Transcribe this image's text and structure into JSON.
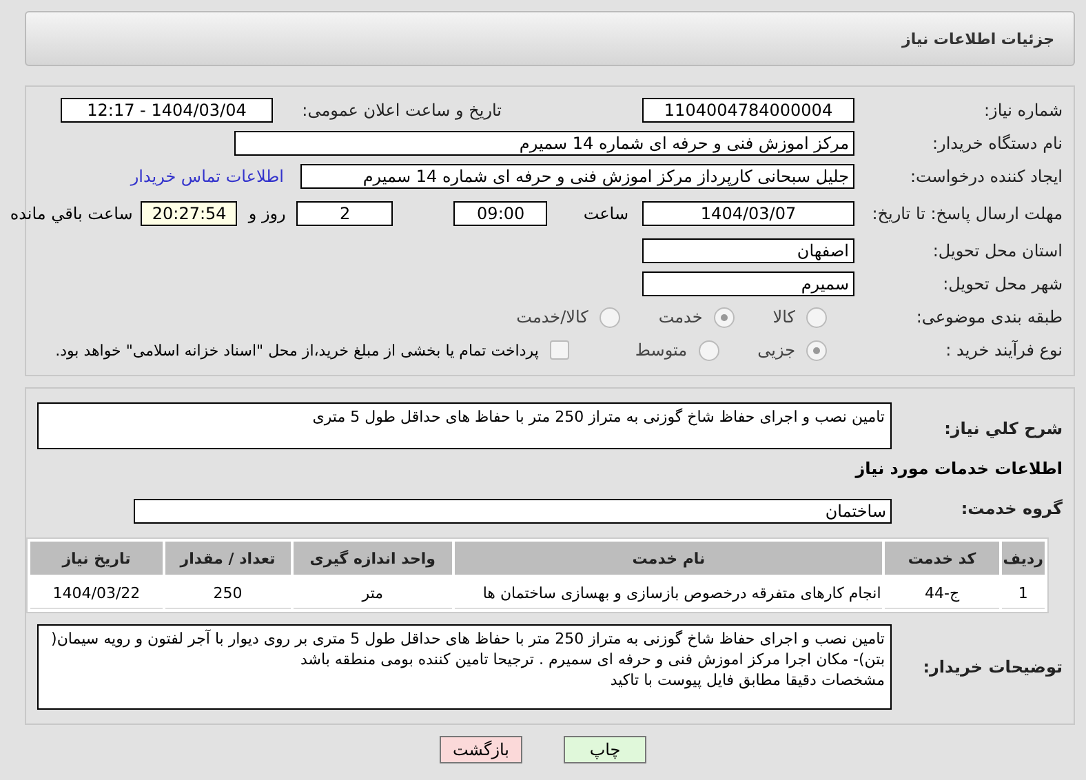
{
  "header": {
    "title": "جزئیات اطلاعات نیاز"
  },
  "need_number": {
    "label": "شماره نیاز:",
    "value": "1104004784000004"
  },
  "announce": {
    "label": "تاریخ و ساعت اعلان عمومی:",
    "value": "1404/03/04 - 12:17"
  },
  "buyer": {
    "label": "نام دستگاه خریدار:",
    "value": "مرکز اموزش فنی و حرفه ای شماره 14  سمیرم"
  },
  "creator": {
    "label": "ایجاد کننده درخواست:",
    "value": "جلیل سبحانی کارپرداز مرکز اموزش فنی و حرفه ای شماره 14  سمیرم",
    "link": "اطلاعات تماس خریدار"
  },
  "deadline": {
    "label": "مهلت ارسال پاسخ: تا تاریخ:",
    "date": "1404/03/07",
    "time_label": "ساعت",
    "time": "09:00",
    "days": "2",
    "days_label": "روز و",
    "remaining": "20:27:54",
    "remaining_label": "ساعت باقي مانده"
  },
  "province": {
    "label": "استان محل تحویل:",
    "value": "اصفهان"
  },
  "city": {
    "label": "شهر محل تحویل:",
    "value": "سمیرم"
  },
  "category": {
    "label": "طبقه بندی موضوعی:",
    "options": [
      {
        "label": "کالا",
        "selected": false,
        "disabled": true
      },
      {
        "label": "خدمت",
        "selected": true,
        "disabled": true
      },
      {
        "label": "کالا/خدمت",
        "selected": false,
        "disabled": true
      }
    ]
  },
  "purchase_type": {
    "label": "نوع فرآیند خرید :",
    "options": [
      {
        "label": "جزیی",
        "selected": true,
        "disabled": true
      },
      {
        "label": "متوسط",
        "selected": false,
        "disabled": true
      }
    ],
    "treasury": {
      "checked": false,
      "label": "پرداخت تمام یا بخشی از مبلغ خرید،از محل \"اسناد خزانه اسلامی\" خواهد بود."
    }
  },
  "summary": {
    "label": "شرح کلي نياز:",
    "value": "تامین نصب و اجرای حفاظ شاخ گوزنی به متراز 250 متر با حفاظ های حداقل طول 5 متری"
  },
  "services_title": "اطلاعات خدمات مورد نیاز",
  "service_group": {
    "label": "گروه خدمت:",
    "value": "ساختمان"
  },
  "table": {
    "columns": [
      "ردیف",
      "کد خدمت",
      "نام خدمت",
      "واحد اندازه گیری",
      "تعداد / مقدار",
      "تاریخ نیاز"
    ],
    "rows": [
      [
        "1",
        "ج-44",
        "انجام کارهای متفرقه درخصوص بازسازی و بهسازی ساختمان ها",
        "متر",
        "250",
        "1404/03/22"
      ]
    ]
  },
  "buyer_notes": {
    "label": "توضیحات خریدار:",
    "value": "تامین نصب و اجرای حفاظ شاخ گوزنی به متراز 250 متر با حفاظ های حداقل طول 5 متری بر روی دیوار با آجر لفتون و رویه سیمان( بتن)- مکان اجرا مرکز اموزش فنی و حرفه ای سمیرم . ترجیحا تامین کننده بومی منطقه باشد\nمشخصات دقیقا مطابق فایل پیوست با تاکید"
  },
  "buttons": [
    {
      "label": "چاپ",
      "kind": "print"
    },
    {
      "label": "بازگشت",
      "kind": "back"
    }
  ]
}
